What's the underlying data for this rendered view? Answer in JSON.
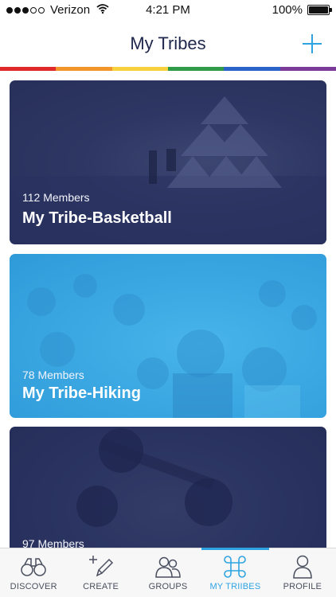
{
  "status_bar": {
    "carrier": "Verizon",
    "time": "4:21 PM",
    "battery": "100%",
    "battery_level": 1.0,
    "signal_bars_filled": 3,
    "signal_bars_total": 5
  },
  "header": {
    "title": "My Tribes",
    "add_icon": "plus-icon"
  },
  "rainbow_colors": [
    "#e0292b",
    "#f2962b",
    "#f7d23e",
    "#2f9a47",
    "#2b63c8",
    "#7a3c98"
  ],
  "tribes": [
    {
      "members": "112 Members",
      "name": "My Tribe-Basketball",
      "color": "#2d3561"
    },
    {
      "members": "78 Members",
      "name": "My Tribe-Hiking",
      "color": "#3aa7e2"
    },
    {
      "members": "97 Members",
      "name": "",
      "color": "#2a3360"
    }
  ],
  "tab_bar": {
    "active": "my-tribes",
    "accent": "#2fa3e0",
    "tabs": [
      {
        "id": "discover",
        "label": "DISCOVER",
        "icon": "binoculars-icon"
      },
      {
        "id": "create",
        "label": "CREATE",
        "icon": "pencil-plus-icon"
      },
      {
        "id": "groups",
        "label": "GROUPS",
        "icon": "people-icon"
      },
      {
        "id": "my-tribes",
        "label": "MY TRIIBES",
        "icon": "command-knot-icon"
      },
      {
        "id": "profile",
        "label": "PROFILE",
        "icon": "person-icon"
      }
    ]
  }
}
